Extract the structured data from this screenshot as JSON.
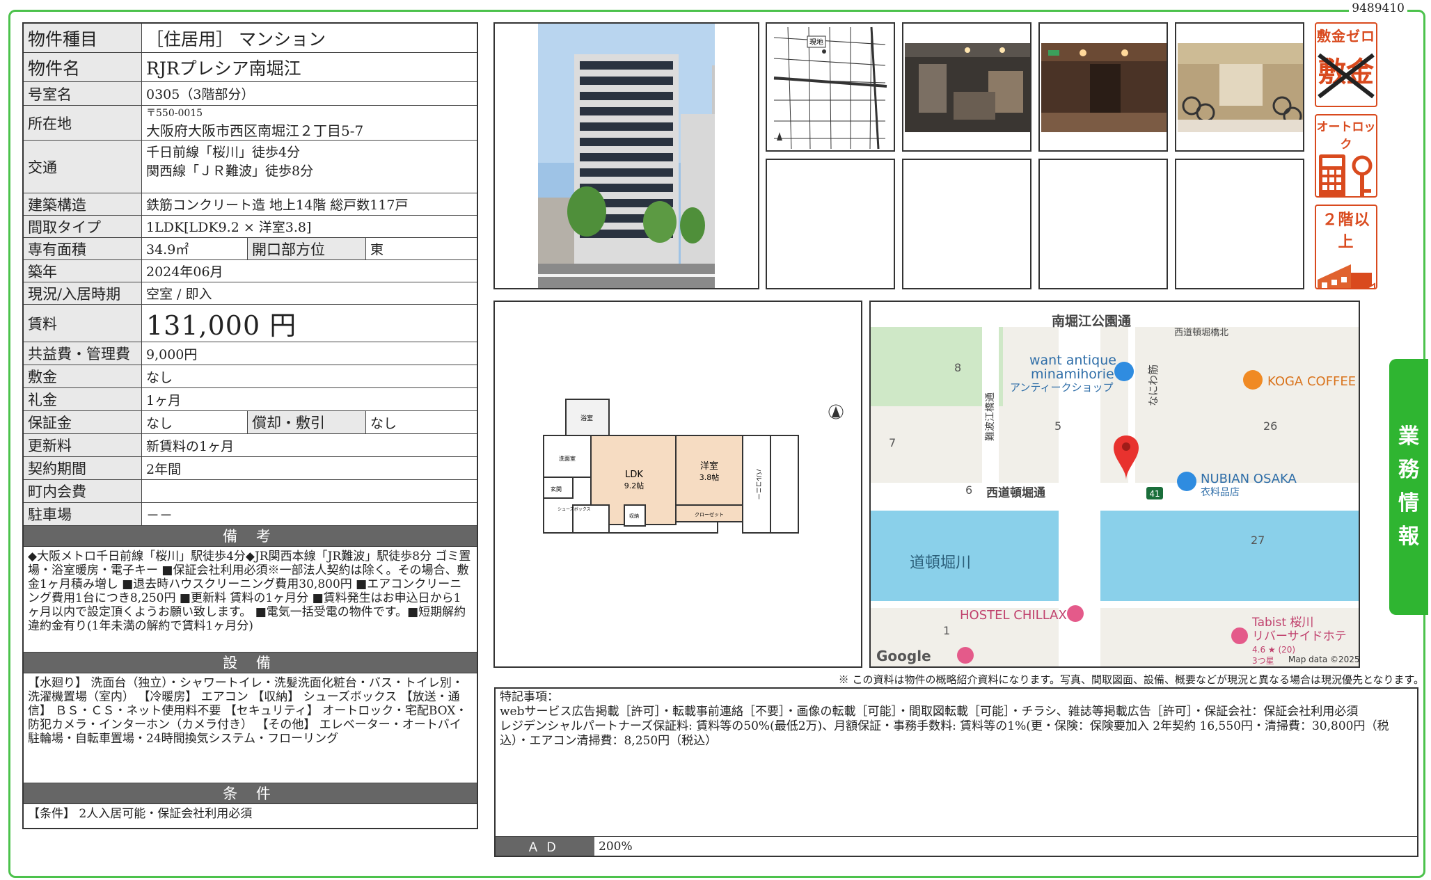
{
  "doc_id": "9489410",
  "property": {
    "type_label": "物件種目",
    "type_value": "［住居用］ マンション",
    "name_label": "物件名",
    "name_value": "RJRプレシア南堀江",
    "room_label": "号室名",
    "room_value": "0305（3階部分）",
    "address_label": "所在地",
    "postal": "〒550-0015",
    "address": "大阪府大阪市西区南堀江２丁目5-7",
    "access_label": "交通",
    "access_1": "千日前線「桜川」徒歩4分",
    "access_2": "関西線「ＪＲ難波」徒歩8分",
    "structure_label": "建築構造",
    "structure_value": "鉄筋コンクリート造 地上14階 総戸数117戸",
    "layout_label": "間取タイプ",
    "layout_value": "1LDK[LDK9.2 × 洋室3.8]",
    "area_label": "専有面積",
    "area_value": "34.9㎡",
    "direction_label": "開口部方位",
    "direction_value": "東",
    "built_label": "築年",
    "built_value": "2024年06月",
    "status_label": "現況/入居時期",
    "status_value": "空室 / 即入",
    "rent_label": "賃料",
    "rent_value": "131,000 円",
    "fee_label": "共益費・管理費",
    "fee_value": "9,000円",
    "deposit_label": "敷金",
    "deposit_value": "なし",
    "key_money_label": "礼金",
    "key_money_value": "1ヶ月",
    "guarantee_label": "保証金",
    "guarantee_value": "なし",
    "amort_label": "償却・敷引",
    "amort_value": "なし",
    "renewal_label": "更新料",
    "renewal_value": "新賃料の1ヶ月",
    "term_label": "契約期間",
    "term_value": "2年間",
    "town_fee_label": "町内会費",
    "town_fee_value": "",
    "parking_label": "駐車場",
    "parking_value": "－－"
  },
  "notes": {
    "heading": "備 考",
    "text": "◆大阪メトロ千日前線「桜川」駅徒歩4分◆JR関西本線「JR難波」駅徒歩8分 ゴミ置場・浴室暖房・電子キー ■保証会社利用必須※一部法人契約は除く。その場合、敷金1ヶ月積み増し ■退去時ハウスクリーニング費用30,800円 ■エアコンクリーニング費用1台につき8,250円 ■更新料 賃料の1ヶ月分 ■賃料発生はお申込日から1ヶ月以内で設定頂くようお願い致します。 ■電気一括受電の物件です。■短期解約違約金有り(1年未満の解約で賃料1ヶ月分)"
  },
  "facilities": {
    "heading": "設 備",
    "text": "【水廻り】 洗面台（独立）・シャワートイレ・洗髪洗面化粧台・バス・トイレ別・洗濯機置場（室内） 【冷暖房】 エアコン 【収納】 シューズボックス 【放送・通信】 ＢＳ・ＣＳ・ネット使用料不要 【セキュリティ】 オートロック・宅配BOX・防犯カメラ・インターホン（カメラ付き） 【その他】 エレベーター・オートバイ駐輪場・自転車置場・24時間換気システム・フローリング"
  },
  "conditions": {
    "heading": "条 件",
    "text": "【条件】 2人入居可能・保証会社利用必須"
  },
  "floorplan": {
    "ldk": "LDK",
    "ldk_size": "9.2帖",
    "western": "洋室",
    "western_size": "3.8帖",
    "bath": "浴室",
    "wash": "洗面室",
    "entrance": "玄関",
    "closet": "クローゼット",
    "balcony": "バルコニー",
    "storage": "収納",
    "shoes": "シューズボックス"
  },
  "thumb_map_label": "現地",
  "badges": {
    "deposit_zero": "敷金ゼロ",
    "deposit_crossed": "敷金",
    "autolock": "オートロック",
    "second_floor": "２階以上"
  },
  "side_tab": [
    "業",
    "務",
    "情",
    "報"
  ],
  "map": {
    "street_top": "南堀江公園通",
    "bridge": "西道頓堀橋北",
    "shop1": "want antique",
    "shop1b": "minamihorie",
    "shop1c": "アンティークショップ",
    "street_v": "なにわ筋",
    "street_v2": "難波江橋通",
    "cafe": "KOGA COFFEE",
    "shop2": "NUBIAN OSAKA",
    "shop2b": "衣料品店",
    "street_mid": "西道頓堀通",
    "route": "41",
    "river": "道頓堀川",
    "hostel": "HOSTEL CHILLAX",
    "hotel": "Tabist 桜川",
    "hotel2": "リバーサイドホテ",
    "hotel_rating": "4.6 ★ (20)",
    "hotel_stars": "3つ星",
    "logo": "Google",
    "copyright": "Map data ©2025",
    "blocks": [
      "8",
      "5",
      "26",
      "7",
      "6",
      "27",
      "1"
    ]
  },
  "disclaimer": "※ この資料は物件の概略紹介資料になります。写真、間取図面、設備、概要などが現況と異なる場合は現況優先となります。",
  "remarks": {
    "title": "特記事項：",
    "line1": "webサービス広告掲載［許可］・転載事前連絡［不要］・画像の転載［可能］・間取図転載［可能］・チラシ、雑誌等掲載広告［許可］・保証会社：保証会社利用必須",
    "line2": "レジデンシャルパートナーズ保証料: 賃料等の50%(最低2万)、月額保証・事務手数料: 賃料等の1%(更・保険：保険要加入 2年契約 16,550円・清掃費：30,800円（税込）・エアコン清掃費：8,250円（税込）"
  },
  "ad": {
    "label": "ＡＤ",
    "value": "200%"
  }
}
